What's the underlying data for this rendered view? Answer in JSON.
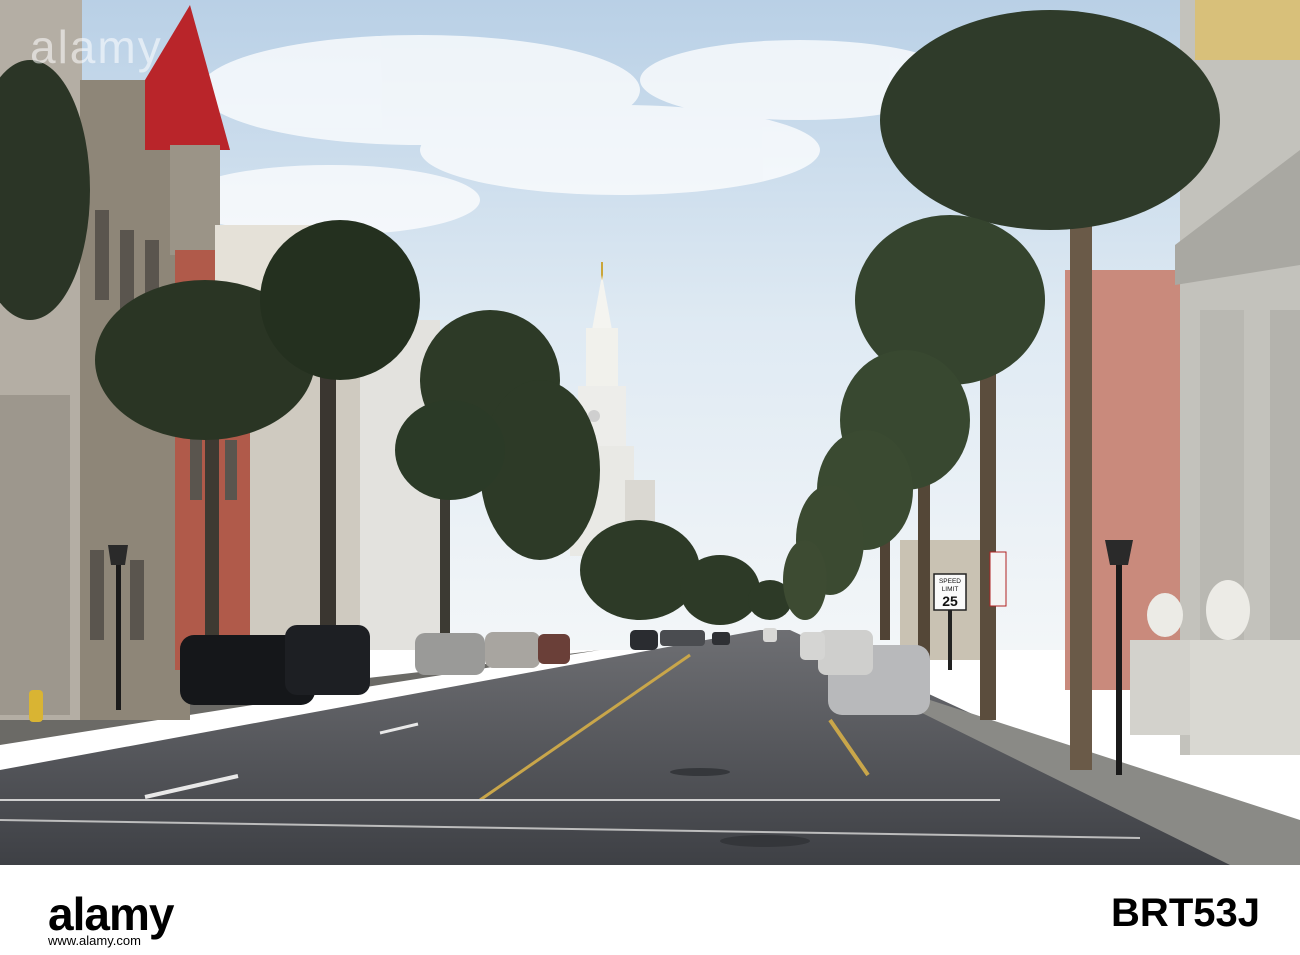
{
  "photo": {
    "description_free": true,
    "watermark_repeat": "alamy",
    "speed_sign": {
      "line1": "SPEED",
      "line2": "LIMIT",
      "value": "25"
    }
  },
  "footer": {
    "logo": "alamy",
    "subline": "www.alamy.com",
    "image_code": "BRT53J"
  },
  "colors": {
    "sky": "#dde9f2",
    "road": "#4a4d52",
    "steeple": "#f2f2ee",
    "roof_red": "#b9252a",
    "pink_wall": "#c98a7c",
    "palm_dark": "#253021"
  }
}
